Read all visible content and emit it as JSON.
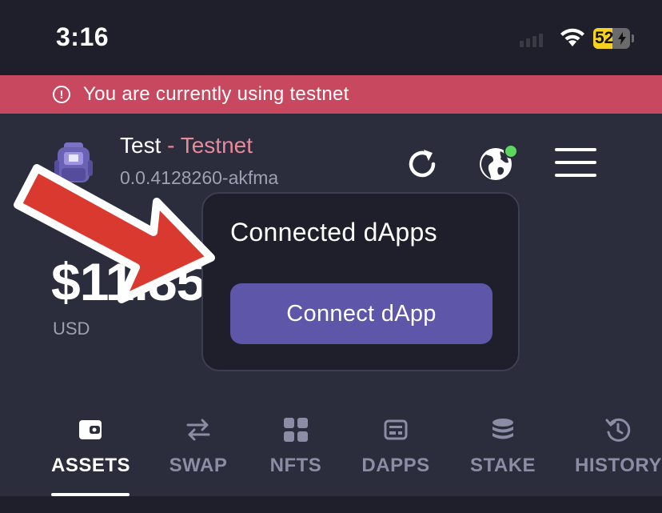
{
  "status_bar": {
    "time": "3:16",
    "battery": "52"
  },
  "banner": {
    "text": "You are currently using testnet",
    "color": "#c8485f"
  },
  "account": {
    "name": "Test",
    "network": " - Testnet",
    "id": "0.0.4128260-akfma"
  },
  "header_icons": [
    "refresh-icon",
    "globe-icon",
    "menu-icon"
  ],
  "balance": {
    "amount": "$11.85",
    "currency": "USD"
  },
  "popup": {
    "title": "Connected dApps",
    "button": "Connect dApp"
  },
  "tabs": [
    {
      "label": "ASSETS",
      "icon": "wallet-icon",
      "active": true
    },
    {
      "label": "SWAP",
      "icon": "swap-icon",
      "active": false
    },
    {
      "label": "NFTS",
      "icon": "grid-icon",
      "active": false
    },
    {
      "label": "DAPPS",
      "icon": "dapps-icon",
      "active": false
    },
    {
      "label": "STAKE",
      "icon": "stake-icon",
      "active": false
    },
    {
      "label": "HISTORY",
      "icon": "history-icon",
      "active": false
    }
  ],
  "colors": {
    "accent": "#5e56a8",
    "background": "#2b2d3c",
    "annotation_arrow": "#d9392f"
  }
}
